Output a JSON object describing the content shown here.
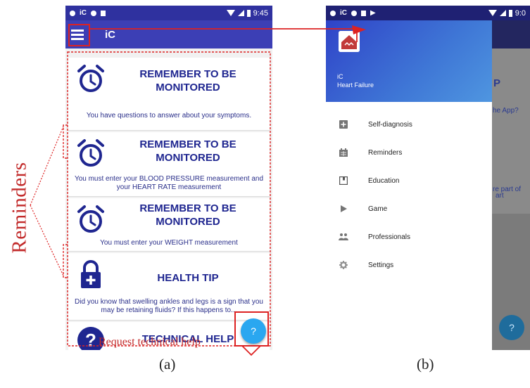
{
  "phone_a": {
    "status_time": "9:45",
    "app_title": "iC",
    "cards": [
      {
        "icon": "alarm-clock-icon",
        "title": "REMEMBER TO BE MONITORED",
        "body": "You have questions to answer about your symptoms."
      },
      {
        "icon": "alarm-clock-icon",
        "title": "REMEMBER TO BE MONITORED",
        "body": "You must enter your BLOOD PRESSURE measurement and your HEART RATE measurement"
      },
      {
        "icon": "alarm-clock-icon",
        "title": "REMEMBER TO BE MONITORED",
        "body": "You must enter your WEIGHT measurement"
      },
      {
        "icon": "lock-plus-icon",
        "title": "HEALTH TIP",
        "body": "Did you know that swelling ankles and legs is a sign that you may be retaining fluids? If this happens to..."
      },
      {
        "icon": "question-circle-icon",
        "title": "TECHNICAL HELP",
        "body": ""
      }
    ],
    "fab_label": "?"
  },
  "phone_b": {
    "status_time": "9:0",
    "drawer_app_name": "iC",
    "drawer_condition": "Heart Failure",
    "menu": [
      {
        "label": "Self-diagnosis",
        "icon": "plus-box-icon"
      },
      {
        "label": "Reminders",
        "icon": "calendar-icon"
      },
      {
        "label": "Education",
        "icon": "book-icon"
      },
      {
        "label": "Game",
        "icon": "play-icon"
      },
      {
        "label": "Professionals",
        "icon": "people-icon"
      },
      {
        "label": "Settings",
        "icon": "gear-icon"
      }
    ],
    "background_fragments": [
      "P",
      "he App?",
      "re part of",
      "art"
    ],
    "fab_label": "?"
  },
  "annotations": {
    "reminders": "Reminders",
    "request_help": "Request technical help",
    "caption_a": "(a)",
    "caption_b": "(b)"
  },
  "colors": {
    "primary": "#3c3fb5",
    "statusbar": "#2f319f",
    "card_title": "#1f2690",
    "fab": "#2aa7f0",
    "annotation": "#c22a2a"
  }
}
